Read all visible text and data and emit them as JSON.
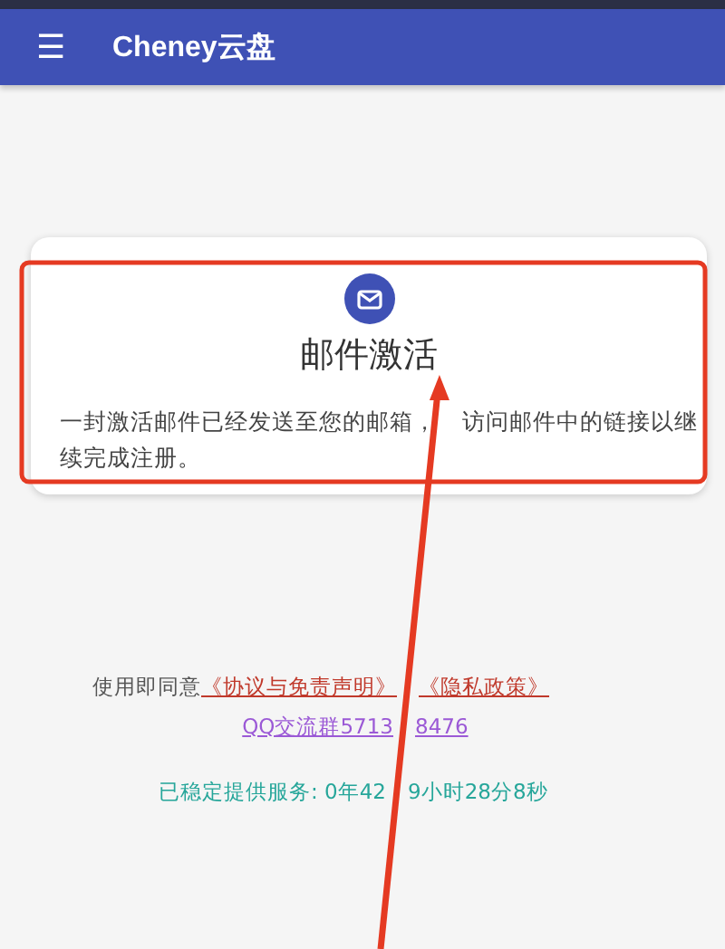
{
  "app_bar": {
    "menu_icon": "☰",
    "title": "Cheney云盘"
  },
  "card": {
    "title": "邮件激活",
    "body_line_1": [
      "一封激活邮件已经发送至您的邮箱，",
      "访问邮件中的链接以继"
    ],
    "body_line_2": "续完成注册。"
  },
  "footer": {
    "agreement_prefix": "使用即同意",
    "agreement_links": [
      "《协议与免责声明》",
      "《隐私政策》"
    ],
    "qq_link": [
      "QQ交流群5713",
      "8476"
    ],
    "uptime": [
      "已稳定提供服务: 0年42",
      "9小时28分8秒"
    ]
  }
}
